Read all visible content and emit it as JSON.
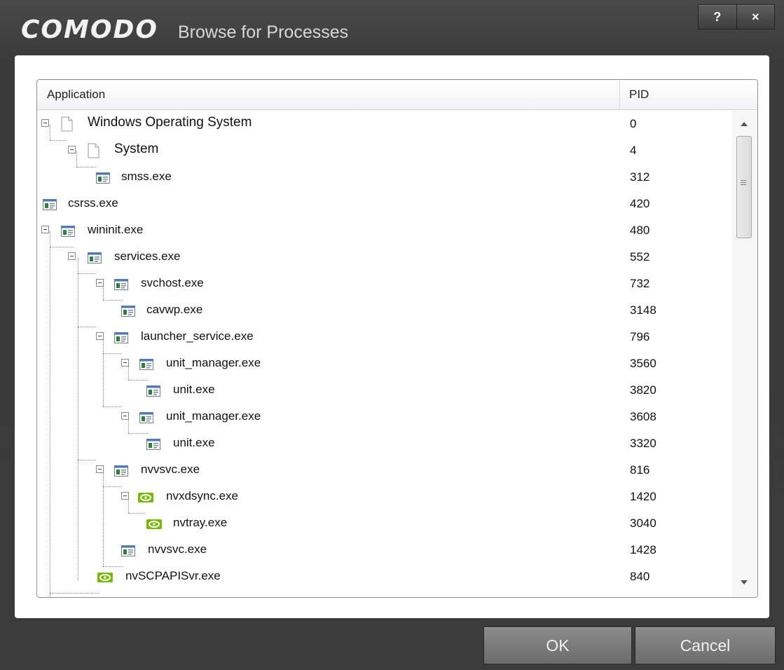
{
  "window": {
    "brand": "COMODO",
    "title": "Browse for Processes",
    "help_label": "?",
    "close_label": "×"
  },
  "table": {
    "columns": {
      "application": "Application",
      "pid": "PID"
    },
    "rows": [
      {
        "name": "Windows Operating System",
        "pid": "0",
        "icon": "document-icon"
      },
      {
        "name": "System",
        "pid": "4",
        "icon": "document-icon"
      },
      {
        "name": "smss.exe",
        "pid": "312",
        "icon": "application-icon"
      },
      {
        "name": "csrss.exe",
        "pid": "420",
        "icon": "application-icon"
      },
      {
        "name": "wininit.exe",
        "pid": "480",
        "icon": "application-icon"
      },
      {
        "name": "services.exe",
        "pid": "552",
        "icon": "application-icon"
      },
      {
        "name": "svchost.exe",
        "pid": "732",
        "icon": "application-icon"
      },
      {
        "name": "cavwp.exe",
        "pid": "3148",
        "icon": "application-icon"
      },
      {
        "name": "launcher_service.exe",
        "pid": "796",
        "icon": "application-icon"
      },
      {
        "name": "unit_manager.exe",
        "pid": "3560",
        "icon": "application-icon"
      },
      {
        "name": "unit.exe",
        "pid": "3820",
        "icon": "application-icon"
      },
      {
        "name": "unit_manager.exe",
        "pid": "3608",
        "icon": "application-icon"
      },
      {
        "name": "unit.exe",
        "pid": "3320",
        "icon": "application-icon"
      },
      {
        "name": "nvvsvc.exe",
        "pid": "816",
        "icon": "application-icon"
      },
      {
        "name": "nvxdsync.exe",
        "pid": "1420",
        "icon": "nvidia-icon"
      },
      {
        "name": "nvtray.exe",
        "pid": "3040",
        "icon": "nvidia-icon"
      },
      {
        "name": "nvvsvc.exe",
        "pid": "1428",
        "icon": "application-icon"
      },
      {
        "name": "nvSCPAPISvr.exe",
        "pid": "840",
        "icon": "nvidia-icon"
      }
    ]
  },
  "buttons": {
    "ok": "OK",
    "cancel": "Cancel"
  },
  "colors": {
    "window_bg": "#3e3e3e",
    "button_bg": "#7b7b7b",
    "nvidia_green": "#76b900"
  }
}
